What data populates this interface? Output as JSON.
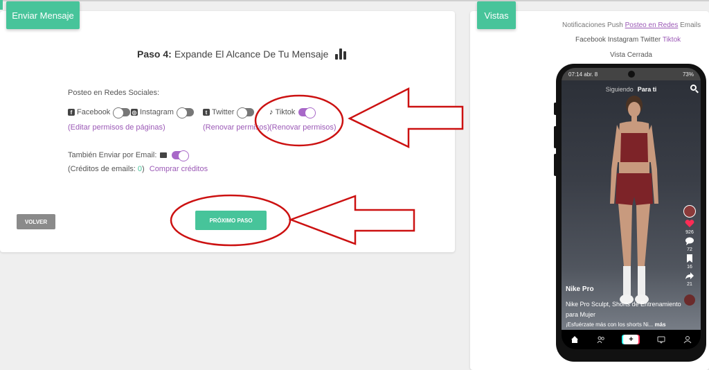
{
  "left_panel": {
    "badge": "Enviar Mensaje",
    "step_prefix": "Paso 4:",
    "step_title": "Expande El Alcance De Tu Mensaje",
    "section_label": "Posteo en Redes Sociales:",
    "socials": [
      {
        "name": "Facebook",
        "icon": "facebook-icon",
        "enabled": false,
        "link": "(Editar permisos de páginas)"
      },
      {
        "name": "Instagram",
        "icon": "instagram-icon",
        "enabled": false,
        "link": ""
      },
      {
        "name": "Twitter",
        "icon": "twitter-icon",
        "enabled": false,
        "link": "(Renovar permisos)"
      },
      {
        "name": "Tiktok",
        "icon": "tiktok-icon",
        "enabled": true,
        "link": "(Renovar permisos)"
      }
    ],
    "email_label": "También Enviar por Email:",
    "email_enabled": true,
    "credits_prefix": "(Créditos de emails:",
    "credits_count": "0",
    "credits_suffix": ")",
    "buy_credits": "Comprar créditos",
    "back_button": "VOLVER",
    "next_button": "PRÓXIMO PASO"
  },
  "right_panel": {
    "badge": "Vistas",
    "tabs": [
      "Notificaciones Push",
      "Posteo en Redes",
      "Emails"
    ],
    "selected_tab": "Posteo en Redes",
    "networks": [
      "Facebook",
      "Instagram",
      "Twitter",
      "Tiktok"
    ],
    "selected_network": "Tiktok",
    "view_mode": "Vista Cerrada",
    "phone": {
      "time": "07:14 abr. 8",
      "battery": "73%",
      "feed_following": "Siguiendo",
      "feed_for_you": "Para ti",
      "likes": "926",
      "comments": "72",
      "saves": "16",
      "shares": "21",
      "author": "Nike Pro",
      "caption_line1": "Nike Pro Sculpt, Shorts de Entrenamiento",
      "caption_line2": "para Mujer",
      "caption_line3": "¡Esfuérzate más con los shorts Ni...",
      "more": "más"
    }
  },
  "colors": {
    "accent_green": "#47c49a",
    "accent_purple": "#9b59b6",
    "annotation_red": "#cc1111"
  }
}
